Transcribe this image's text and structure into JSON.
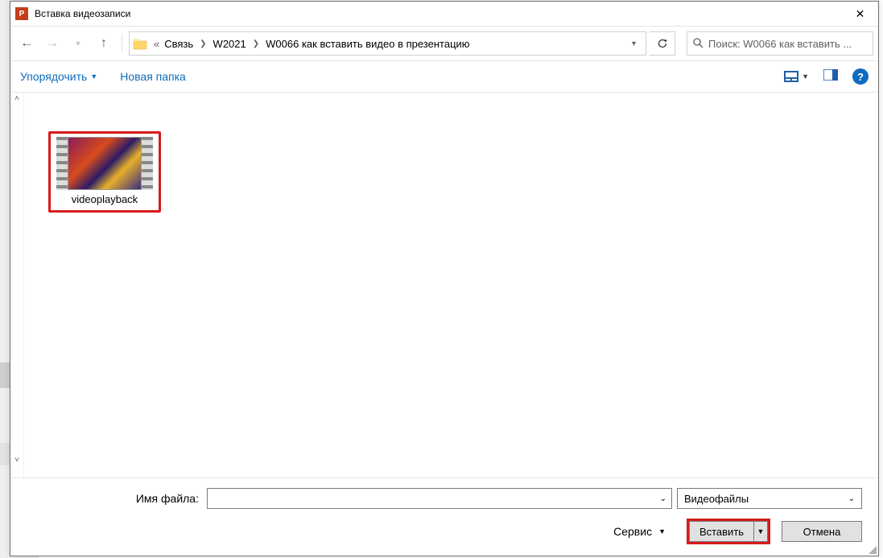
{
  "titlebar": {
    "app_letter": "P",
    "title": "Вставка видеозаписи",
    "close": "✕"
  },
  "nav": {
    "back": "←",
    "forward": "→",
    "up": "↑",
    "addr_prefix": "«",
    "crumbs": [
      "Связь",
      "W2021",
      "W0066 как вставить видео в презентацию"
    ],
    "refresh": "⟳",
    "search_placeholder": "Поиск: W0066 как вставить ..."
  },
  "cmdbar": {
    "organize": "Упорядочить",
    "new_folder": "Новая папка",
    "help": "?"
  },
  "files": [
    {
      "name": "videoplayback"
    }
  ],
  "bottom": {
    "filename_label": "Имя файла:",
    "filename_value": "",
    "filetype": "Видеофайлы",
    "service": "Сервис",
    "insert": "Вставить",
    "cancel": "Отмена"
  }
}
